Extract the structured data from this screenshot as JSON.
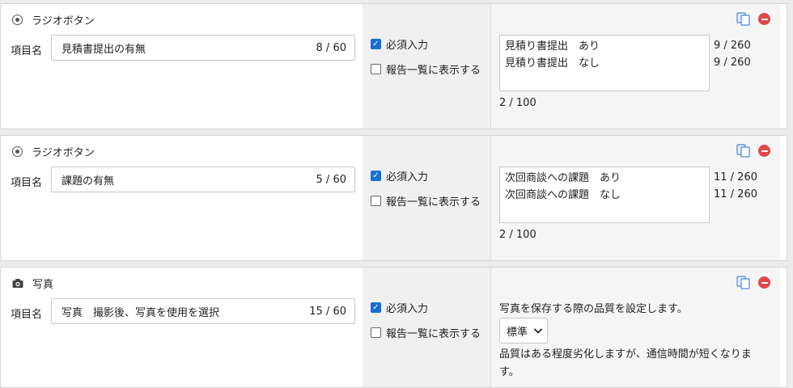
{
  "common": {
    "item_name_label": "項目名",
    "required_label": "必須入力",
    "show_in_report_label": "報告一覧に表示する"
  },
  "items": [
    {
      "type_icon": "radio-icon",
      "type_label": "ラジオボタン",
      "name": "見積書提出の有無",
      "name_count": "8 / 60",
      "required": true,
      "show_in_report": false,
      "options": [
        "見積り書提出　あり",
        "見積り書提出　なし"
      ],
      "option_counts": [
        "9 / 260",
        "9 / 260"
      ],
      "options_total": "2 / 100"
    },
    {
      "type_icon": "radio-icon",
      "type_label": "ラジオボタン",
      "name": "課題の有無",
      "name_count": "5 / 60",
      "required": true,
      "show_in_report": false,
      "options": [
        "次回商談への課題　あり",
        "次回商談への課題　なし"
      ],
      "option_counts": [
        "11 / 260",
        "11 / 260"
      ],
      "options_total": "2 / 100"
    },
    {
      "type_icon": "camera-icon",
      "type_label": "写真",
      "name": "写真　撮影後、写真を使用を選択",
      "name_count": "15 / 60",
      "required": true,
      "show_in_report": false,
      "quality_description": "写真を保存する際の品質を設定します。",
      "quality_value": "標準",
      "quality_note": "品質はある程度劣化しますが、通信時間が短くなります。"
    }
  ],
  "colors": {
    "checkbox_checked": "#1a6fd6",
    "delete_icon": "#e04848",
    "copy_icon": "#4a86d8",
    "settings_panel_bg": "#f5f5f5"
  }
}
